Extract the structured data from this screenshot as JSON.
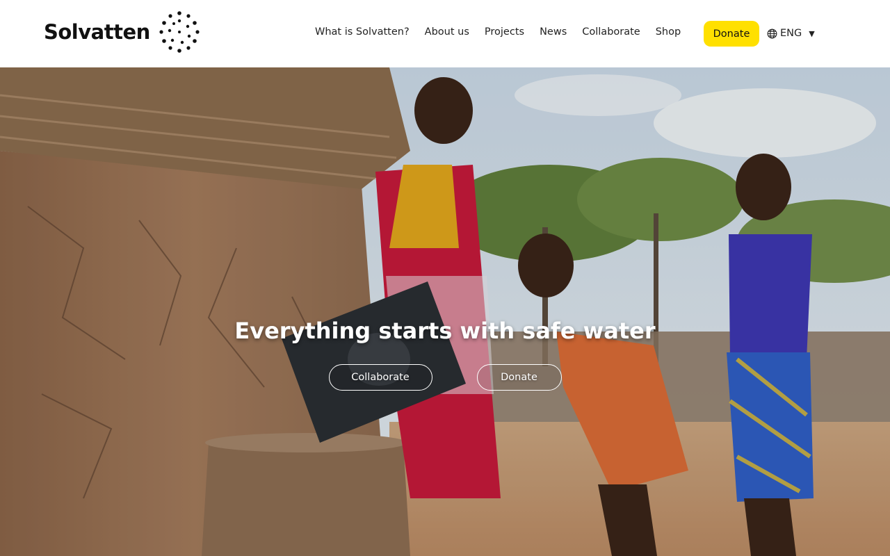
{
  "brand": {
    "name": "Solvatten",
    "accent_color": "#ffe000"
  },
  "nav": {
    "items": [
      {
        "label": "What is Solvatten?"
      },
      {
        "label": "About us"
      },
      {
        "label": "Projects"
      },
      {
        "label": "News"
      },
      {
        "label": "Collaborate"
      },
      {
        "label": "Shop"
      }
    ],
    "donate_label": "Donate",
    "language": {
      "label": "ENG",
      "icon": "globe-icon"
    }
  },
  "hero": {
    "title": "Everything starts with safe water",
    "buttons": {
      "collaborate": "Collaborate",
      "donate": "Donate"
    }
  }
}
